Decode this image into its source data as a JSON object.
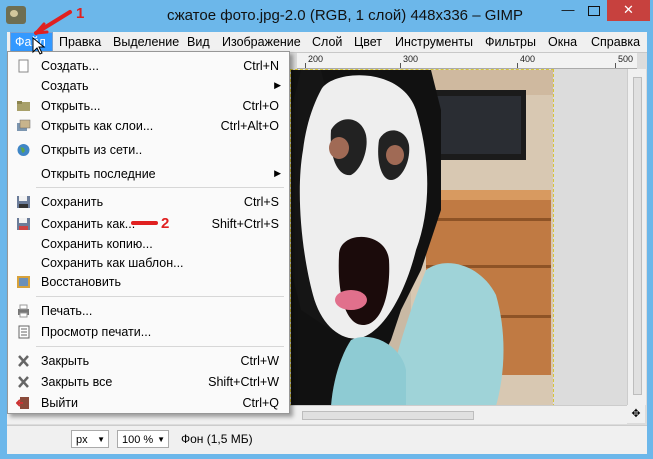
{
  "window": {
    "title": "сжатое фото.jpg-2.0 (RGB, 1 слой) 448x336 – GIMP",
    "min_glyph": "—",
    "close_glyph": "✕"
  },
  "menubar": [
    "Файл",
    "Правка",
    "Выделение",
    "Вид",
    "Изображение",
    "Слой",
    "Цвет",
    "Инструменты",
    "Фильтры",
    "Окна",
    "Справка"
  ],
  "ruler": {
    "labels": [
      "200",
      "300",
      "400",
      "500"
    ]
  },
  "file_menu": {
    "items": [
      {
        "label": "Создать...",
        "shortcut": "Ctrl+N",
        "icon": "new-document-icon"
      },
      {
        "label": "Создать",
        "shortcut": "",
        "submenu": true
      },
      {
        "label": "Открыть...",
        "shortcut": "Ctrl+O",
        "icon": "open-folder-icon"
      },
      {
        "label": "Открыть как слои...",
        "shortcut": "Ctrl+Alt+O",
        "icon": "open-layers-icon"
      },
      {
        "label": "Открыть из сети..",
        "shortcut": "",
        "icon": "globe-icon"
      },
      {
        "label": "Открыть последние",
        "shortcut": "",
        "submenu": true
      },
      {
        "label": "Сохранить",
        "shortcut": "Ctrl+S",
        "icon": "save-icon"
      },
      {
        "label": "Сохранить как...",
        "shortcut": "Shift+Ctrl+S",
        "icon": "save-as-icon"
      },
      {
        "label": "Сохранить копию...",
        "shortcut": ""
      },
      {
        "label": "Сохранить как шаблон...",
        "shortcut": ""
      },
      {
        "label": "Восстановить",
        "shortcut": "",
        "icon": "revert-icon"
      },
      {
        "label": "Печать...",
        "shortcut": "",
        "icon": "print-icon"
      },
      {
        "label": "Просмотр печати...",
        "shortcut": "",
        "icon": "print-preview-icon"
      },
      {
        "label": "Закрыть",
        "shortcut": "Ctrl+W",
        "icon": "close-x-icon"
      },
      {
        "label": "Закрыть все",
        "shortcut": "Shift+Ctrl+W",
        "icon": "close-all-icon"
      },
      {
        "label": "Выйти",
        "shortcut": "Ctrl+Q",
        "icon": "quit-icon"
      }
    ]
  },
  "annotations": {
    "one": "1",
    "two": "2"
  },
  "statusbar": {
    "unit": "px",
    "zoom": "100 %",
    "info": "Фон (1,5 МБ)"
  },
  "colors": {
    "titlebar": "#6cb7ea",
    "menu_highlight": "#3399ff",
    "annotation": "#e02020",
    "close_button": "#c7413e"
  }
}
